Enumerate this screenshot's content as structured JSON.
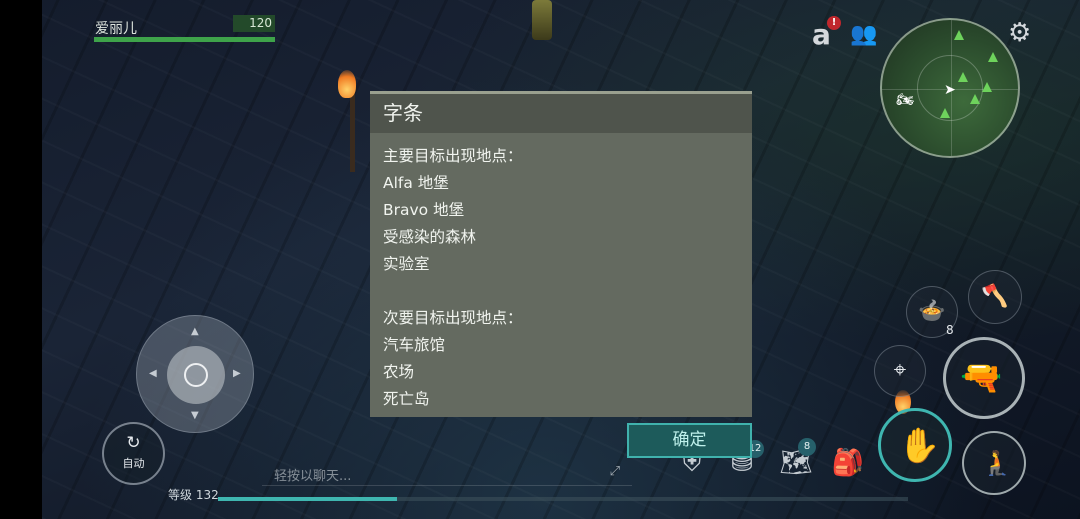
{
  "player": {
    "name": "爱丽儿",
    "hp": "120",
    "hp_fraction": 1.0
  },
  "top_icons": {
    "alert_badge": "!",
    "amazon_icon": "a-icon",
    "friends_icon": "friends-icon",
    "settings_icon": "gear-icon"
  },
  "dialog": {
    "title": "字条",
    "lines": [
      "主要目标出现地点：",
      "Alfa 地堡",
      "Bravo 地堡",
      "受感染的森林",
      "实验室",
      "",
      "次要目标出现地点：",
      "汽车旅馆",
      "农场",
      "死亡岛"
    ],
    "confirm_label": "确定"
  },
  "controls": {
    "auto_label": "自动",
    "ammo_count": "8"
  },
  "chat": {
    "placeholder": "轻按以聊天..."
  },
  "level": {
    "label": "等级 132",
    "xp_fraction": 0.26
  },
  "bottom_bar": {
    "coins_badge": "12",
    "map_badge": "8"
  },
  "colors": {
    "accent": "#40b2ad",
    "hp_green": "#3ea34a",
    "dialog_bg": "#646a60"
  }
}
